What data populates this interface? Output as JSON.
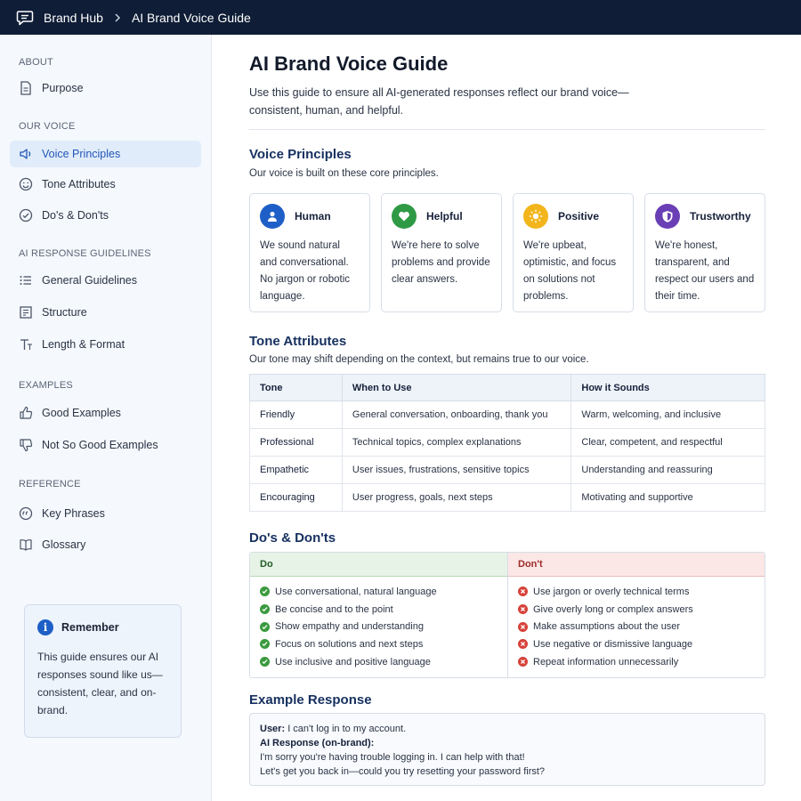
{
  "header": {
    "app_name": "Brand Hub",
    "page": "AI Brand Voice Guide"
  },
  "sidebar": {
    "sections": [
      {
        "title": "ABOUT",
        "items": [
          {
            "label": "Purpose",
            "icon": "document-icon"
          }
        ]
      },
      {
        "title": "OUR VOICE",
        "items": [
          {
            "label": "Voice Principles",
            "icon": "speaker-icon",
            "active": true
          },
          {
            "label": "Tone Attributes",
            "icon": "smile-icon"
          },
          {
            "label": "Do's & Don'ts",
            "icon": "check-circle-icon"
          }
        ]
      },
      {
        "title": "AI RESPONSE GUIDELINES",
        "items": [
          {
            "label": "General Guidelines",
            "icon": "list-icon"
          },
          {
            "label": "Structure",
            "icon": "structure-icon"
          },
          {
            "label": "Length & Format",
            "icon": "text-size-icon"
          }
        ]
      },
      {
        "title": "EXAMPLES",
        "items": [
          {
            "label": "Good Examples",
            "icon": "thumbs-up-icon"
          },
          {
            "label": "Not So Good Examples",
            "icon": "thumbs-down-icon"
          }
        ]
      },
      {
        "title": "REFERENCE",
        "items": [
          {
            "label": "Key Phrases",
            "icon": "quote-icon"
          },
          {
            "label": "Glossary",
            "icon": "book-icon"
          }
        ]
      }
    ],
    "remember": {
      "title": "Remember",
      "text": "This guide ensures our AI responses sound like us—consistent, clear, and on-brand."
    }
  },
  "main": {
    "title": "AI Brand Voice Guide",
    "intro": "Use this guide to ensure all AI-generated responses reflect our brand voice—consistent, human, and helpful.",
    "principles": {
      "heading": "Voice Principles",
      "subtitle": "Our voice is built on these core principles.",
      "cards": [
        {
          "title": "Human",
          "text": "We sound natural and conversational. No jargon or robotic language.",
          "color": "#1d5fc6",
          "icon": "person-icon"
        },
        {
          "title": "Helpful",
          "text": "We're here to solve problems and provide clear answers.",
          "color": "#2f9a45",
          "icon": "heart-icon"
        },
        {
          "title": "Positive",
          "text": "We're upbeat, optimistic, and focus on solutions not problems.",
          "color": "#f2b51b",
          "icon": "sun-icon"
        },
        {
          "title": "Trustworthy",
          "text": "We're honest, transparent, and respect our users and their time.",
          "color": "#6a3fb5",
          "icon": "shield-icon"
        }
      ]
    },
    "tone": {
      "heading": "Tone Attributes",
      "subtitle": "Our tone may shift depending on the context, but remains true to our voice.",
      "columns": [
        "Tone",
        "When to Use",
        "How it Sounds"
      ],
      "rows": [
        [
          "Friendly",
          "General conversation, onboarding, thank you",
          "Warm, welcoming, and inclusive"
        ],
        [
          "Professional",
          "Technical topics, complex explanations",
          "Clear, competent, and respectful"
        ],
        [
          "Empathetic",
          "User issues, frustrations, sensitive topics",
          "Understanding and reassuring"
        ],
        [
          "Encouraging",
          "User progress, goals, next steps",
          "Motivating and supportive"
        ]
      ]
    },
    "dos_donts": {
      "heading": "Do's & Don'ts",
      "do_label": "Do",
      "dont_label": "Don't",
      "do_items": [
        "Use conversational, natural language",
        "Be concise and to the point",
        "Show empathy and understanding",
        "Focus on solutions and next steps",
        "Use inclusive and positive language"
      ],
      "dont_items": [
        "Use jargon or overly technical terms",
        "Give overly long or complex answers",
        "Make assumptions about the user",
        "Use negative or dismissive language",
        "Repeat information unnecessarily"
      ]
    },
    "example": {
      "heading": "Example Response",
      "user_label": "User:",
      "user_text": "I can't log in to my account.",
      "ai_label": "AI Response (on-brand):",
      "ai_line1": "I'm sorry you're having trouble logging in. I can help with that!",
      "ai_line2": "Let's get you back in—could you try resetting your password first?"
    }
  }
}
